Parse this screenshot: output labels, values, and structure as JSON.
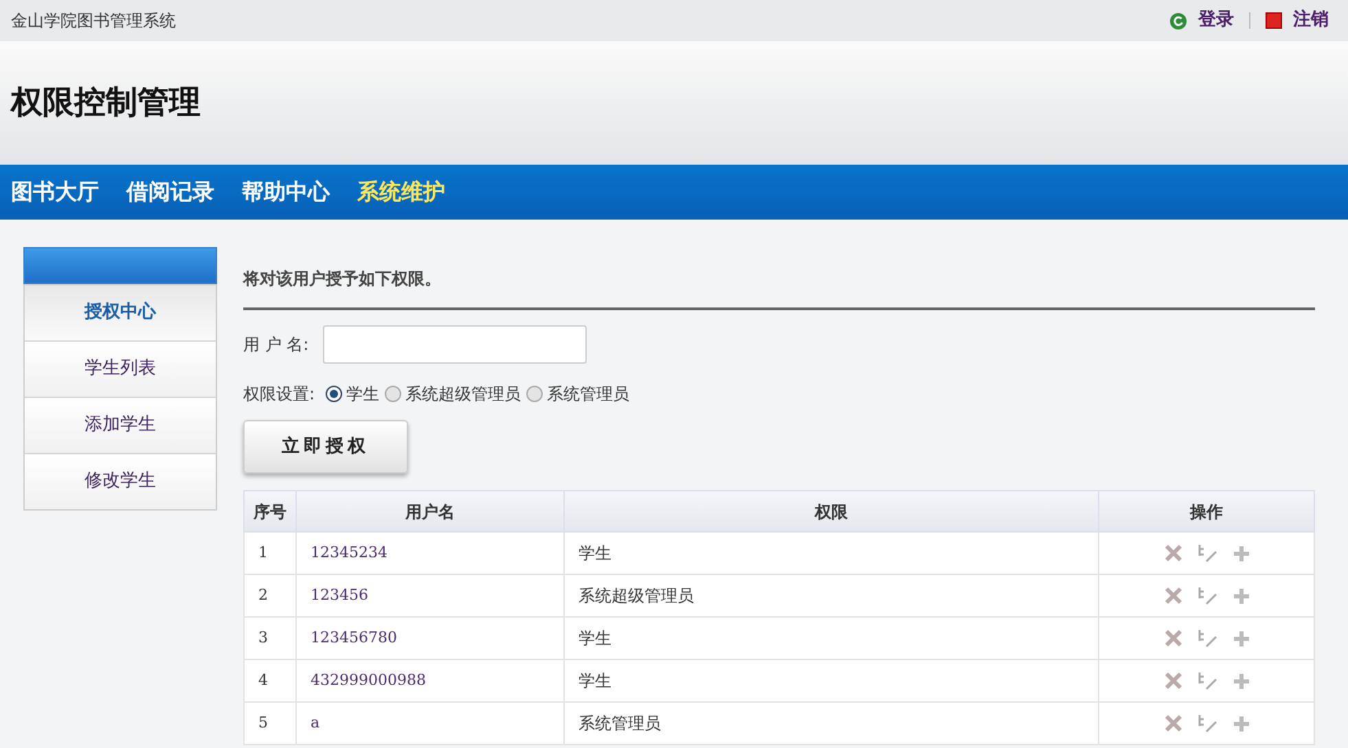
{
  "top_bar": {
    "site_name": "金山学院图书管理系统",
    "links": [
      {
        "kind": "login",
        "label": "登录"
      },
      {
        "kind": "logout",
        "label": "注销"
      }
    ]
  },
  "page_title": "权限控制管理",
  "nav": [
    {
      "label": "图书大厅",
      "selected": false
    },
    {
      "label": "借阅记录",
      "selected": false
    },
    {
      "label": "帮助中心",
      "selected": false
    },
    {
      "label": "系统维护",
      "selected": true
    }
  ],
  "sidebar": [
    {
      "label": "授权中心",
      "selected": true
    },
    {
      "label": "学生列表",
      "selected": false
    },
    {
      "label": "添加学生",
      "selected": false
    },
    {
      "label": "修改学生",
      "selected": false
    }
  ],
  "form": {
    "heading": "将对该用户授予如下权限。",
    "username_label": "用 户 名:",
    "role_label": "权限设置:",
    "roles": [
      {
        "label": "学生",
        "selected": true
      },
      {
        "label": "系统超级管理员",
        "selected": false
      },
      {
        "label": "系统管理员",
        "selected": false
      }
    ],
    "submit": "立即授权"
  },
  "table": {
    "columns": [
      "序号",
      "用户名",
      "权限",
      "操作"
    ],
    "rows": [
      {
        "no": "1",
        "username": "12345234",
        "role": "学生"
      },
      {
        "no": "2",
        "username": "123456",
        "role": "系统超级管理员"
      },
      {
        "no": "3",
        "username": "123456780",
        "role": "学生"
      },
      {
        "no": "4",
        "username": "432999000988",
        "role": "学生"
      },
      {
        "no": "5",
        "username": "a",
        "role": "系统管理员"
      }
    ]
  }
}
